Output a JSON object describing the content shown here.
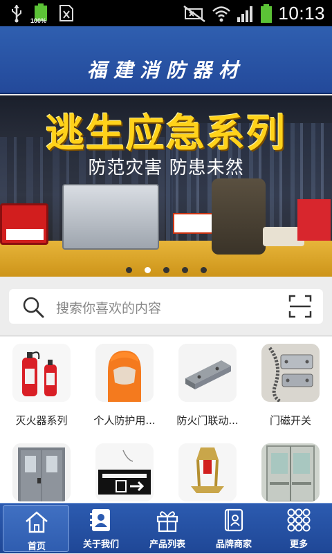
{
  "status_bar": {
    "battery_left_label": "100%",
    "time": "10:13",
    "icons": [
      "usb-icon",
      "battery-icon",
      "sim-icon",
      "mute-icon",
      "wifi-icon",
      "signal-icon",
      "battery-full-icon"
    ]
  },
  "header": {
    "title": "福建消防器材"
  },
  "banner": {
    "headline": "逃生应急系列",
    "subtitle": "防范灾害  防患未然",
    "slide_count": 5,
    "active_slide": 1
  },
  "search": {
    "placeholder": "搜索你喜欢的内容"
  },
  "categories": [
    {
      "label": "灭火器系列"
    },
    {
      "label": "个人防护用..."
    },
    {
      "label": "防火门联动..."
    },
    {
      "label": "门磁开关"
    },
    {
      "label": ""
    },
    {
      "label": ""
    },
    {
      "label": ""
    },
    {
      "label": ""
    }
  ],
  "nav": {
    "items": [
      {
        "label": "首页",
        "icon": "home-icon",
        "active": true
      },
      {
        "label": "关于我们",
        "icon": "contact-card-icon",
        "active": false
      },
      {
        "label": "产品列表",
        "icon": "gift-icon",
        "active": false
      },
      {
        "label": "品牌商家",
        "icon": "brand-book-icon",
        "active": false
      },
      {
        "label": "更多",
        "icon": "grid-dots-icon",
        "active": false
      }
    ]
  },
  "colors": {
    "header_blue": "#2a55a8",
    "headline_yellow": "#ffd21a",
    "status_green": "#5bc236"
  }
}
